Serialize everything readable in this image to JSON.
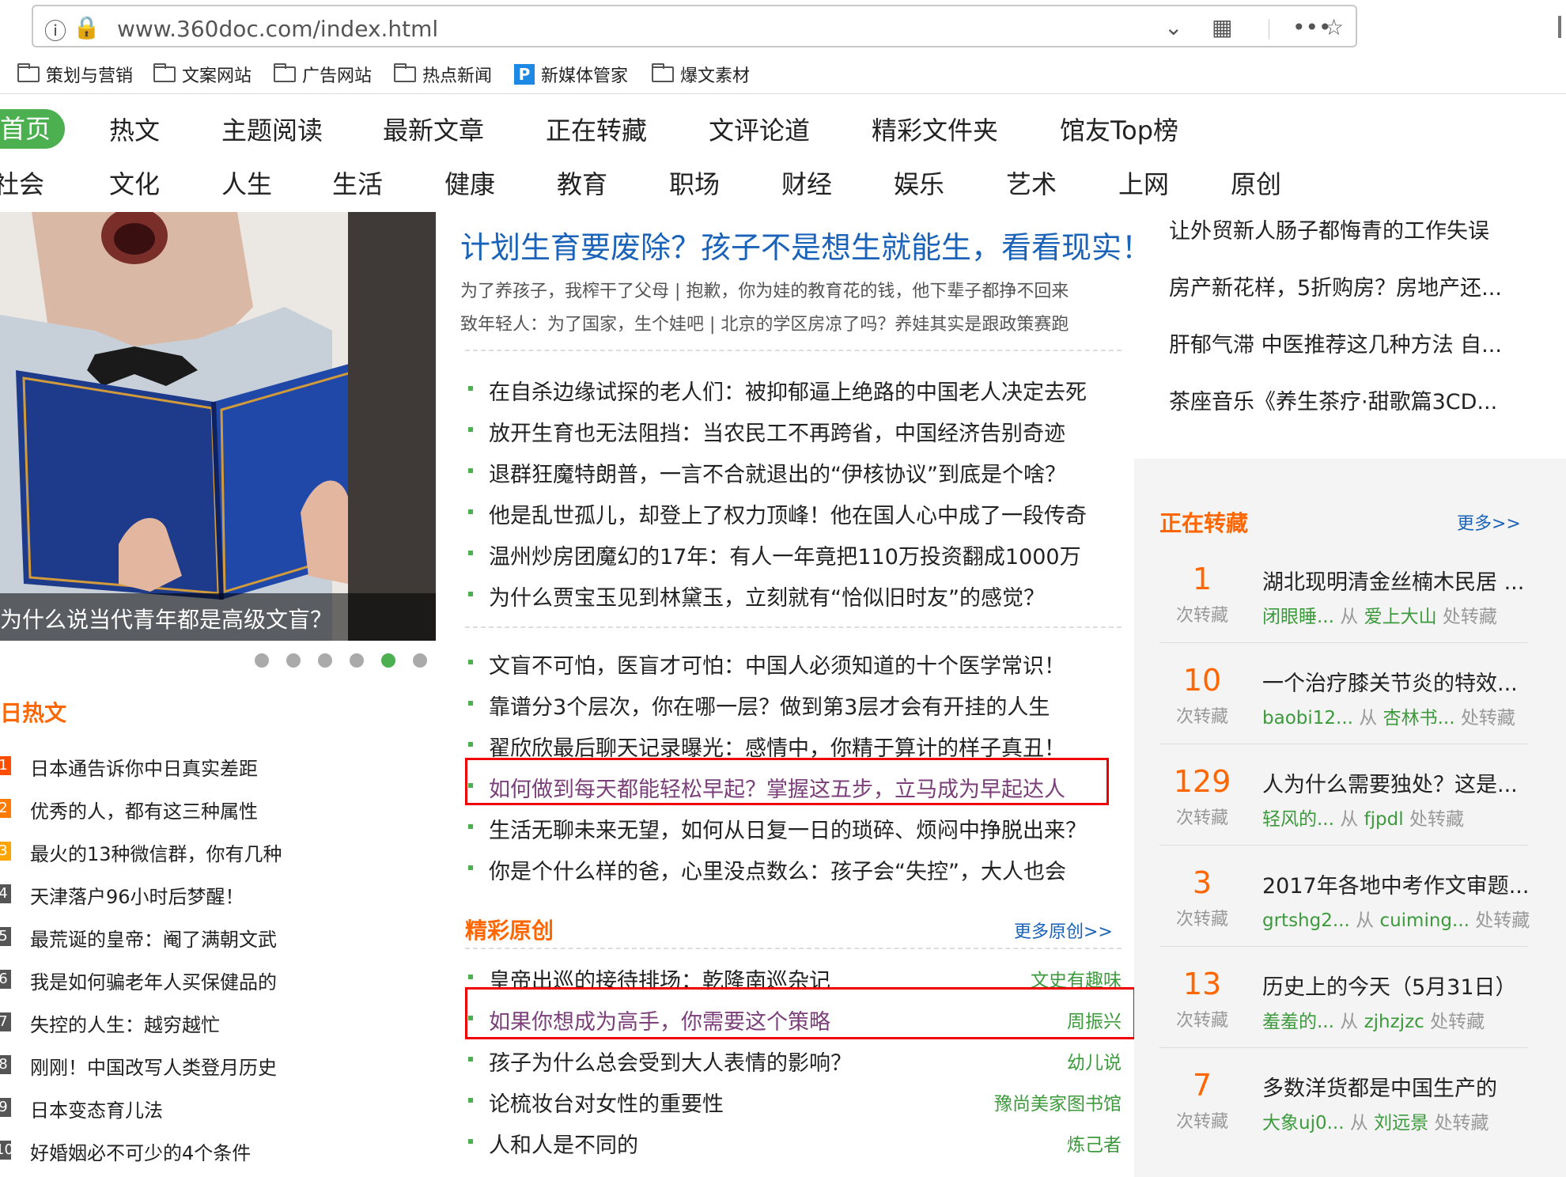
{
  "browser": {
    "url": "www.360doc.com/index.html",
    "bookmarks": [
      {
        "label": "策划与营销",
        "icon": "folder-icon"
      },
      {
        "label": "文案网站",
        "icon": "folder-icon"
      },
      {
        "label": "广告网站",
        "icon": "folder-icon"
      },
      {
        "label": "热点新闻",
        "icon": "folder-icon"
      },
      {
        "label": "新媒体管家",
        "icon": "p-app-icon"
      },
      {
        "label": "爆文素材",
        "icon": "folder-icon"
      }
    ]
  },
  "nav": {
    "row1": [
      "首页",
      "热文",
      "主题阅读",
      "最新文章",
      "正在转藏",
      "文评论道",
      "精彩文件夹",
      "馆友Top榜"
    ],
    "row2": [
      "社会",
      "文化",
      "人生",
      "生活",
      "健康",
      "教育",
      "职场",
      "财经",
      "娱乐",
      "艺术",
      "上网",
      "原创"
    ]
  },
  "hero": {
    "caption": "为什么说当代青年都是高级文盲？",
    "active_dot": 5,
    "dot_count": 6
  },
  "hot": {
    "title": "日热文",
    "items": [
      {
        "num": "1",
        "text": "日本通告诉你中日真实差距"
      },
      {
        "num": "2",
        "text": "优秀的人，都有这三种属性"
      },
      {
        "num": "3",
        "text": "最火的13种微信群，你有几种"
      },
      {
        "num": "4",
        "text": "天津落户96小时后梦醒！"
      },
      {
        "num": "5",
        "text": "最荒诞的皇帝：阉了满朝文武"
      },
      {
        "num": "6",
        "text": "我是如何骗老年人买保健品的"
      },
      {
        "num": "7",
        "text": "失控的人生：越穷越忙"
      },
      {
        "num": "8",
        "text": "刚刚！中国改写人类登月历史"
      },
      {
        "num": "9",
        "text": "日本变态育儿法"
      },
      {
        "num": "10",
        "text": "好婚姻必不可少的4个条件"
      }
    ]
  },
  "main": {
    "headline": "计划生育要废除？孩子不是想生就能生，看看现实！",
    "sub1": "为了养孩子，我榨干了父母 | 抱歉，你为娃的教育花的钱，他下辈子都挣不回来",
    "sub2": "致年轻人：为了国家，生个娃吧 | 北京的学区房凉了吗？养娃其实是跟政策赛跑",
    "group1": [
      "在自杀边缘试探的老人们：被抑郁逼上绝路的中国老人决定去死",
      "放开生育也无法阻挡：当农民工不再跨省，中国经济告别奇迹",
      "退群狂魔特朗普，一言不合就退出的“伊核协议”到底是个啥？",
      "他是乱世孤儿，却登上了权力顶峰！他在国人心中成了一段传奇",
      "温州炒房团魔幻的17年：有人一年竟把110万投资翻成1000万",
      "为什么贾宝玉见到林黛玉，立刻就有“恰似旧时友”的感觉？"
    ],
    "group2": [
      "文盲不可怕，医盲才可怕：中国人必须知道的十个医学常识！",
      "靠谱分3个层次，你在哪一层？做到第3层才会有开挂的人生",
      "翟欣欣最后聊天记录曝光：感情中，你精于算计的样子真丑！",
      "如何做到每天都能轻松早起？掌握这五步，立马成为早起达人",
      "生活无聊未来无望，如何从日复一日的琐碎、烦闷中挣脱出来？",
      "你是个什么样的爸，心里没点数么：孩子会“失控”，大人也会"
    ],
    "original": {
      "title": "精彩原创",
      "more": "更多原创>>",
      "items": [
        {
          "title": "皇帝出巡的接待排场：乾隆南巡杂记",
          "author": "文史有趣味"
        },
        {
          "title": "如果你想成为高手，你需要这个策略",
          "author": "周振兴"
        },
        {
          "title": "孩子为什么总会受到大人表情的影响？",
          "author": "幼儿说"
        },
        {
          "title": "论梳妆台对女性的重要性",
          "author": "豫尚美家图书馆"
        },
        {
          "title": "人和人是不同的",
          "author": "炼己者"
        }
      ]
    }
  },
  "right": {
    "top_links": [
      "让外贸新人肠子都悔青的工作失误",
      "房产新花样，5折购房？房地产还...",
      "肝郁气滞 中医推荐这几种方法 自...",
      "茶座音乐《养生茶疗·甜歌篇3CD..."
    ],
    "zhuancang": {
      "title": "正在转藏",
      "more": "更多>>",
      "label": "次转藏",
      "items": [
        {
          "count": "1",
          "title": "湖北现明清金丝楠木民居 ...",
          "user": "闭眼睡...",
          "from": "从",
          "source": "爱上大山",
          "suffix": "处转藏"
        },
        {
          "count": "10",
          "title": "一个治疗膝关节炎的特效...",
          "user": "baobi12...",
          "from": "从",
          "source": "杏林书...",
          "suffix": "处转藏"
        },
        {
          "count": "129",
          "title": "人为什么需要独处？这是...",
          "user": "轻风的...",
          "from": "从",
          "source": "fjpdl",
          "suffix": "处转藏"
        },
        {
          "count": "3",
          "title": "2017年各地中考作文审题...",
          "user": "grtshg2...",
          "from": "从",
          "source": "cuiming...",
          "suffix": "处转藏"
        },
        {
          "count": "13",
          "title": "历史上的今天（5月31日）",
          "user": "羞羞的...",
          "from": "从",
          "source": "zjhzjzc",
          "suffix": "处转藏"
        },
        {
          "count": "7",
          "title": "多数洋货都是中国生产的",
          "user": "大象uj0...",
          "from": "从",
          "source": "刘远景",
          "suffix": "处转藏"
        }
      ]
    }
  },
  "colors": {
    "accent": "#4caf50",
    "orange": "#ff6600",
    "link": "#1a63b8",
    "highlight": "#e00000"
  }
}
